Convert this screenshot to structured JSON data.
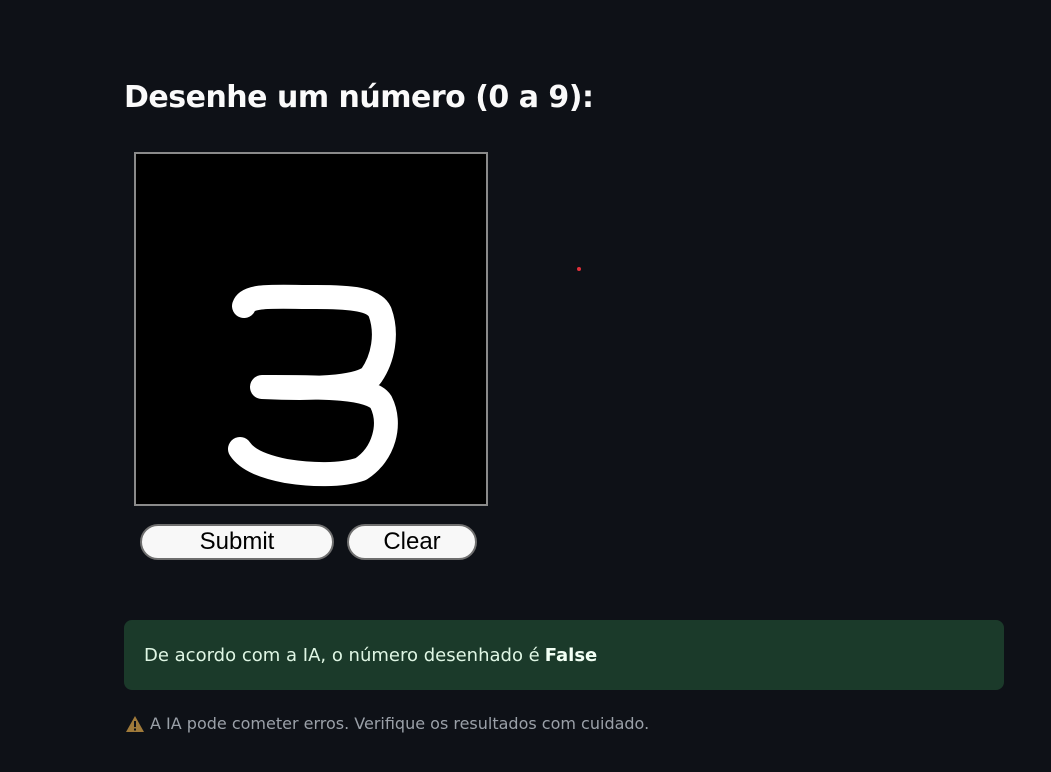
{
  "header": {
    "title": "Desenhe um número (0 a 9):"
  },
  "canvas": {
    "background": "#000000",
    "stroke_color": "#ffffff",
    "drawn_digit": "3"
  },
  "buttons": {
    "submit_label": "Submit",
    "clear_label": "Clear"
  },
  "result": {
    "text": "De acordo com a IA, o número desenhado é",
    "value": "False",
    "background": "#1b3a2a"
  },
  "warning": {
    "icon": "warning-icon",
    "text": "A IA pode cometer erros. Verifique os resultados com cuidado."
  },
  "colors": {
    "page_bg": "#0e1117",
    "cursor_dot": "#e0303a"
  }
}
